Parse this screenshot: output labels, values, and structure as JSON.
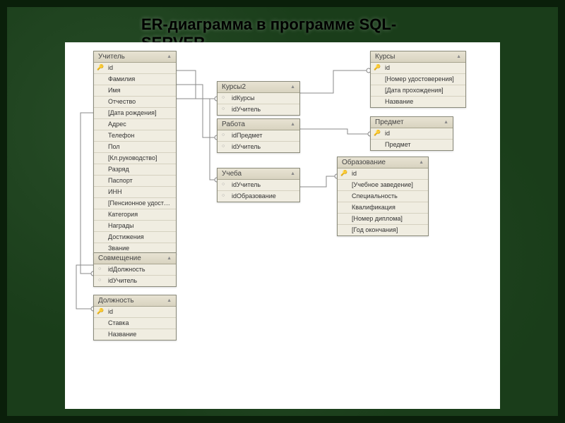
{
  "title": "ER-диаграмма в программе SQL-SERVER",
  "tables": {
    "teacher": {
      "name": "Учитель",
      "cols": [
        "id",
        "Фамилия",
        "Имя",
        "Отчество",
        "[Дата рождения]",
        "Адрес",
        "Телефон",
        "Пол",
        "[Кл.руководство]",
        "Разряд",
        "Паспорт",
        "ИНН",
        "[Пенсионное удостовер…",
        "Категория",
        "Награды",
        "Достижения",
        "Звание"
      ],
      "pk": [
        0
      ]
    },
    "courses2": {
      "name": "Курсы2",
      "cols": [
        "idКурсы",
        "idУчитель"
      ],
      "fk": [
        0,
        1
      ]
    },
    "courses": {
      "name": "Курсы",
      "cols": [
        "id",
        "[Номер удостоверения]",
        "[Дата прохождения]",
        "Название"
      ],
      "pk": [
        0
      ]
    },
    "work": {
      "name": "Работа",
      "cols": [
        "idПредмет",
        "idУчитель"
      ],
      "fk": [
        0,
        1
      ]
    },
    "subject": {
      "name": "Предмет",
      "cols": [
        "id",
        "Предмет"
      ],
      "pk": [
        0
      ]
    },
    "study": {
      "name": "Учеба",
      "cols": [
        "idУчитель",
        "idОбразование"
      ],
      "fk": [
        0,
        1
      ]
    },
    "education": {
      "name": "Образование",
      "cols": [
        "id",
        "[Учебное заведение]",
        "Специальность",
        "Квалификация",
        "[Номер диплома]",
        "[Год окончания]"
      ],
      "pk": [
        0
      ]
    },
    "combine": {
      "name": "Совмещение",
      "cols": [
        "idДолжность",
        "idУчитель"
      ],
      "fk": [
        0,
        1
      ]
    },
    "position": {
      "name": "Должность",
      "cols": [
        "id",
        "Ставка",
        "Название"
      ],
      "pk": [
        0
      ]
    }
  }
}
